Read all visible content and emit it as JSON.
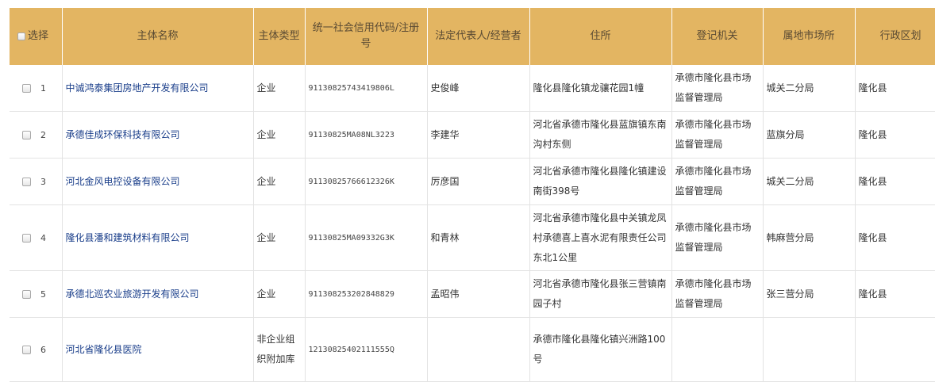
{
  "table": {
    "headers": {
      "select": "选择",
      "name": "主体名称",
      "type": "主体类型",
      "code": "统一社会信用代码/注册号",
      "rep": "法定代表人/经营者",
      "addr": "住所",
      "reg_org": "登记机关",
      "office": "属地市场所",
      "district": "行政区划"
    },
    "rows": [
      {
        "index": "1",
        "name": "中诚鸿泰集团房地产开发有限公司",
        "type": "企业",
        "code": "91130825743419806L",
        "rep": "史俊峰",
        "addr": "隆化县隆化镇龙骧花园1幢",
        "reg_org": "承德市隆化县市场监督管理局",
        "office": "城关二分局",
        "district": "隆化县"
      },
      {
        "index": "2",
        "name": "承德佳成环保科技有限公司",
        "type": "企业",
        "code": "91130825MA08NL3223",
        "rep": "李建华",
        "addr": "河北省承德市隆化县蓝旗镇东南沟村东侧",
        "reg_org": "承德市隆化县市场监督管理局",
        "office": "蓝旗分局",
        "district": "隆化县"
      },
      {
        "index": "3",
        "name": "河北金风电控设备有限公司",
        "type": "企业",
        "code": "91130825766612326K",
        "rep": "厉彦国",
        "addr": "河北省承德市隆化县隆化镇建设南街398号",
        "reg_org": "承德市隆化县市场监督管理局",
        "office": "城关二分局",
        "district": "隆化县"
      },
      {
        "index": "4",
        "name": "隆化县潘和建筑材料有限公司",
        "type": "企业",
        "code": "91130825MA09332G3K",
        "rep": "和青林",
        "addr": "河北省承德市隆化县中关镇龙凤村承德喜上喜水泥有限责任公司东北1公里",
        "reg_org": "承德市隆化县市场监督管理局",
        "office": "韩麻营分局",
        "district": "隆化县"
      },
      {
        "index": "5",
        "name": "承德北巡农业旅游开发有限公司",
        "type": "企业",
        "code": "911308253202848829",
        "rep": "孟昭伟",
        "addr": "河北省承德市隆化县张三营镇南园子村",
        "reg_org": "承德市隆化县市场监督管理局",
        "office": "张三营分局",
        "district": "隆化县"
      },
      {
        "index": "6",
        "name": "河北省隆化县医院",
        "type": "非企业组织附加库",
        "code": "12130825402111555Q",
        "rep": "",
        "addr": "承德市隆化县隆化镇兴洲路100号",
        "reg_org": "",
        "office": "",
        "district": ""
      }
    ]
  }
}
